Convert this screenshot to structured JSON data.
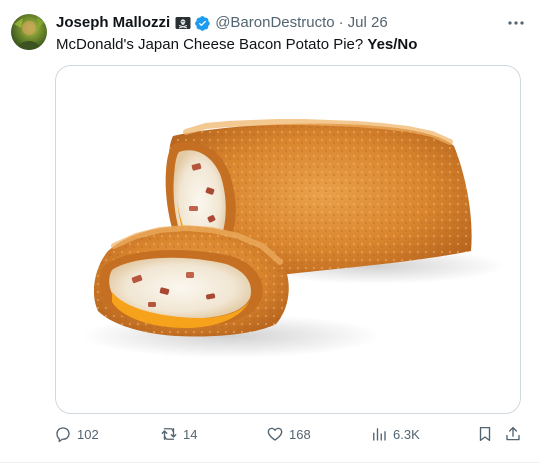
{
  "tweet": {
    "author_name": "Joseph Mallozzi",
    "author_flag_icon": "pirate-flag-icon",
    "verified_icon": "verified-badge-icon",
    "handle": "@BaronDestructo",
    "separator": "·",
    "date": "Jul 26",
    "text_main": "McDonald's Japan Cheese Bacon Potato Pie?",
    "text_bold": "Yes/No",
    "media": {
      "icon": "cheese-bacon-potato-pie-photo"
    }
  },
  "actions": {
    "replies": "102",
    "retweets": "14",
    "likes": "168",
    "views": "6.3K"
  },
  "colors": {
    "text": "#0f1419",
    "muted": "#536471",
    "verified": "#1d9bf0",
    "border": "#cfd9de"
  }
}
